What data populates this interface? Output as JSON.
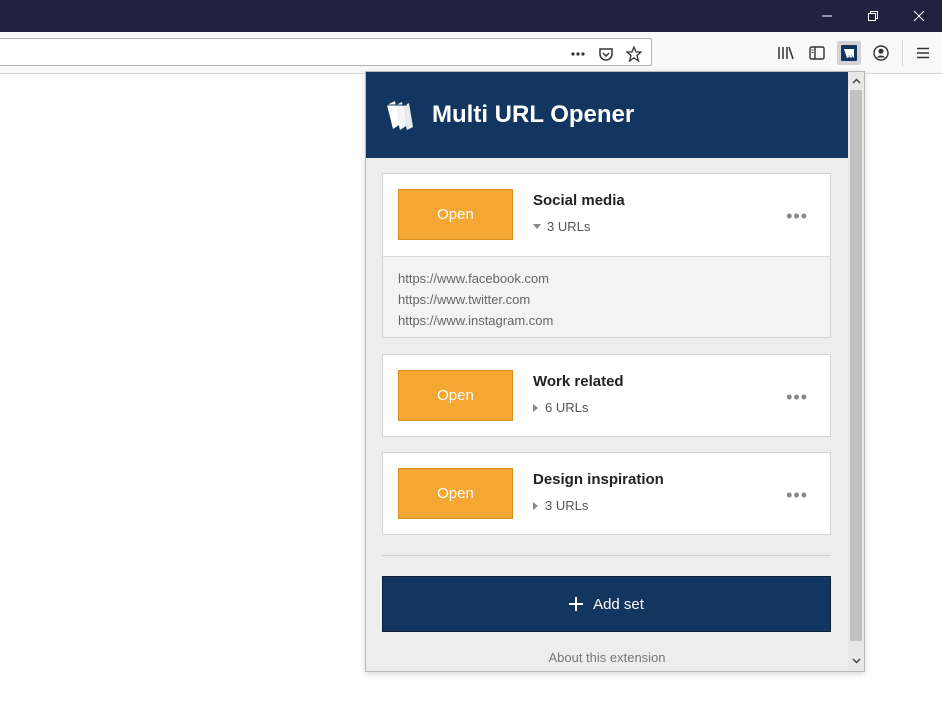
{
  "window": {
    "minimize_icon": "minimize-icon",
    "restore_icon": "restore-icon",
    "close_icon": "close-icon"
  },
  "toolbar": {
    "url_value": "",
    "page_actions_icon": "more-horizontal-icon",
    "pocket_icon": "pocket-icon",
    "bookmark_icon": "star-icon",
    "library_icon": "library-icon",
    "sidebar_icon": "sidebar-icon",
    "extension_icon": "multi-url-opener-icon",
    "account_icon": "account-icon",
    "menu_icon": "hamburger-menu-icon"
  },
  "popup": {
    "title": "Multi URL Opener",
    "sets": [
      {
        "open_label": "Open",
        "name": "Social media",
        "count": "3 URLs",
        "expanded": true,
        "urls": [
          "https://www.facebook.com",
          "https://www.twitter.com",
          "https://www.instagram.com"
        ]
      },
      {
        "open_label": "Open",
        "name": "Work related",
        "count": "6 URLs",
        "expanded": false
      },
      {
        "open_label": "Open",
        "name": "Design inspiration",
        "count": "3 URLs",
        "expanded": false
      }
    ],
    "more_label": "•••",
    "add_set_label": "Add set",
    "about_label": "About this extension"
  },
  "colors": {
    "header": "#133660",
    "open_button": "#f5a733",
    "titlebar": "#202340"
  }
}
